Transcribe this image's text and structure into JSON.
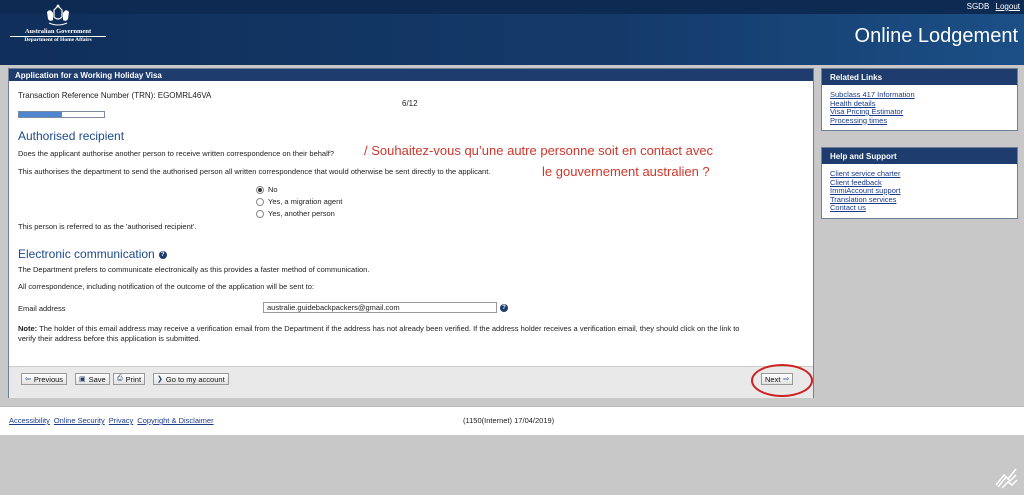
{
  "header": {
    "user": "SGDB",
    "logout": "Logout",
    "gov": "Australian Government",
    "dept": "Department of Home Affairs",
    "app_title": "Online Lodgement"
  },
  "main": {
    "title": "Application for a Working Holiday Visa",
    "trn": "Transaction Reference Number (TRN): EGOMRL46VA",
    "step": "6/12",
    "progress": 0.5,
    "section1": "Authorised recipient",
    "q1": "Does the applicant authorise another person to receive written correspondence on their behalf?",
    "q1_info": "This authorises the department to send the authorised person all written correspondence that would otherwise be sent directly to the applicant.",
    "options": [
      "No",
      "Yes, a migration agent",
      "Yes, another person"
    ],
    "selected": 0,
    "referred": "This person is referred to as the 'authorised recipient'.",
    "section2": "Electronic communication",
    "pref": "The Department prefers to communicate electronically as this provides a faster method of communication.",
    "corr": "All correspondence, including notification of the outcome of the application will be sent to:",
    "email_label": "Email address",
    "email_value": "australie.guidebackpackers@gmail.com",
    "note_label": "Note:",
    "note_line1": "The holder of this email address may receive a verification email from the Department if the address has not already been verified. If the address holder receives a verification email, they should click on the link to",
    "note_line2": "verify their address before this application is submitted.",
    "overlay_line1": "/ Souhaitez-vous qu’une autre personne soit en contact avec",
    "overlay_line2": "le gouvernement australien ?"
  },
  "buttons": {
    "previous": "Previous",
    "save": "Save",
    "print": "Print",
    "account": "Go to my account",
    "next": "Next"
  },
  "related": {
    "title": "Related Links",
    "items": [
      "Subclass 417 Information",
      "Health details",
      "Visa Pricing Estimator",
      "Processing times"
    ]
  },
  "support": {
    "title": "Help and Support",
    "items": [
      "Client service charter",
      "Client feedback",
      "ImmiAccount support",
      "Translation services",
      "Contact us"
    ]
  },
  "footer": {
    "links": [
      "Accessibility",
      "Online Security",
      "Privacy",
      "Copyright & Disclaimer"
    ],
    "version": "(1150(Internet) 17/04/2019)"
  },
  "colors": {
    "navy": "#1e3d6e",
    "accent_red": "#d02020"
  }
}
